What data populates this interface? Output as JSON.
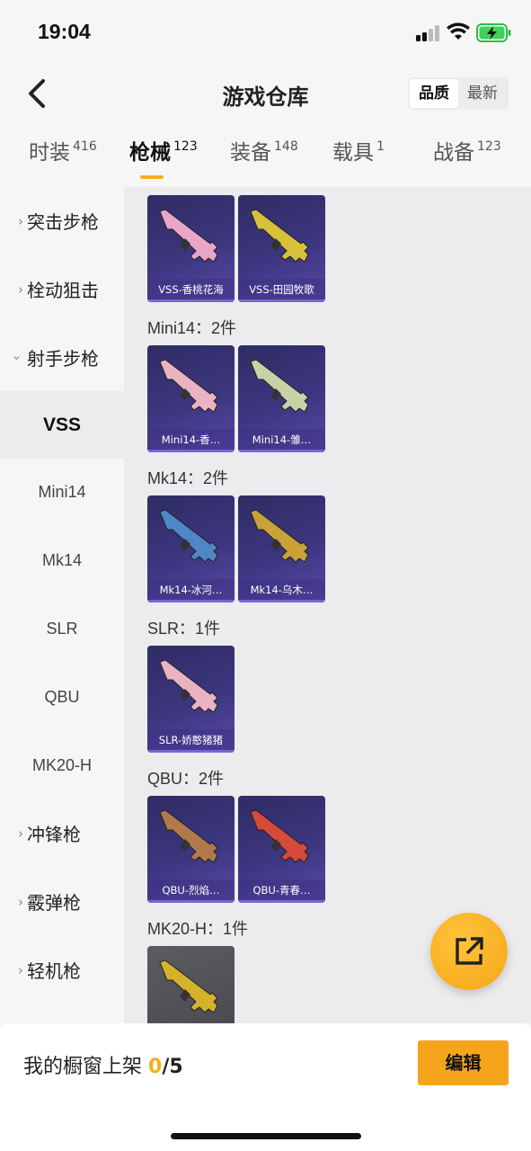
{
  "status_bar": {
    "time": "19:04"
  },
  "header": {
    "title": "游戏仓库",
    "sort_options": [
      "品质",
      "最新"
    ],
    "sort_selected": "品质"
  },
  "tabs": [
    {
      "label": "时装",
      "count": "416"
    },
    {
      "label": "枪械",
      "count": "123",
      "active": true
    },
    {
      "label": "装备",
      "count": "148"
    },
    {
      "label": "载具",
      "count": "1"
    },
    {
      "label": "战备",
      "count": "123"
    }
  ],
  "sidebar": {
    "categories": [
      {
        "label": "突击步枪",
        "expanded": false
      },
      {
        "label": "栓动狙击",
        "expanded": false
      },
      {
        "label": "射手步枪",
        "expanded": true
      }
    ],
    "subitems": [
      "VSS",
      "Mini14",
      "Mk14",
      "SLR",
      "QBU",
      "MK20-H"
    ],
    "selected_subitem": "VSS",
    "more_categories": [
      {
        "label": "冲锋枪"
      },
      {
        "label": "霰弹枪"
      },
      {
        "label": "轻机枪"
      }
    ]
  },
  "groups": [
    {
      "label": "",
      "items": [
        {
          "name": "VSS-香桃花海",
          "color": "#e9a6c8"
        },
        {
          "name": "VSS-田园牧歌",
          "color": "#d6c23a"
        }
      ]
    },
    {
      "label": "Mini14：2件",
      "items": [
        {
          "name": "Mini14-香…",
          "color": "#eab3c4"
        },
        {
          "name": "Mini14-雏…",
          "color": "#c9d1a6"
        }
      ]
    },
    {
      "label": "Mk14：2件",
      "items": [
        {
          "name": "Mk14-冰河…",
          "color": "#4f86c6"
        },
        {
          "name": "Mk14-乌木…",
          "color": "#c9a23a"
        }
      ]
    },
    {
      "label": "SLR：1件",
      "items": [
        {
          "name": "SLR-娇憨猪猪",
          "color": "#eab3c4"
        }
      ]
    },
    {
      "label": "QBU：2件",
      "items": [
        {
          "name": "QBU-烈焰…",
          "color": "#b27a4a"
        },
        {
          "name": "QBU-青春…",
          "color": "#d64a3a"
        }
      ]
    },
    {
      "label": "MK20-H：1件",
      "items": [
        {
          "name": "",
          "color": "#d6b22a",
          "grey": true
        }
      ]
    }
  ],
  "bottom_bar": {
    "shelf_label": "我的橱窗上架 ",
    "shelf_count": "0",
    "shelf_total": "/5",
    "edit_label": "编辑"
  },
  "colors": {
    "accent": "#f5a51c",
    "card_bg": "#3d3680"
  }
}
